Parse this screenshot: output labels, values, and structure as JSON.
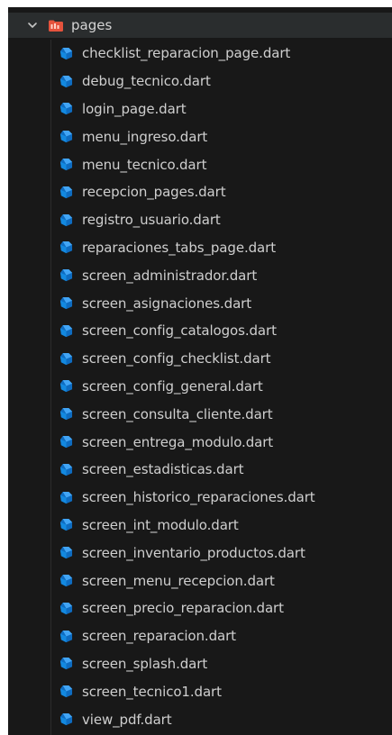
{
  "explorer": {
    "folder": {
      "name": "pages",
      "expanded": true,
      "chevron_icon": "chevron-down-icon",
      "icon": "folder-icon",
      "icon_color": "#e5533d"
    },
    "file_icon": "dart-icon",
    "file_icon_color": "#1a8fe0",
    "files": [
      {
        "name": "checklist_reparacion_page.dart"
      },
      {
        "name": "debug_tecnico.dart"
      },
      {
        "name": "login_page.dart"
      },
      {
        "name": "menu_ingreso.dart"
      },
      {
        "name": "menu_tecnico.dart"
      },
      {
        "name": "recepcion_pages.dart"
      },
      {
        "name": "registro_usuario.dart"
      },
      {
        "name": "reparaciones_tabs_page.dart"
      },
      {
        "name": "screen_administrador.dart"
      },
      {
        "name": "screen_asignaciones.dart"
      },
      {
        "name": "screen_config_catalogos.dart"
      },
      {
        "name": "screen_config_checklist.dart"
      },
      {
        "name": "screen_config_general.dart"
      },
      {
        "name": "screen_consulta_cliente.dart"
      },
      {
        "name": "screen_entrega_modulo.dart"
      },
      {
        "name": "screen_estadisticas.dart"
      },
      {
        "name": "screen_historico_reparaciones.dart"
      },
      {
        "name": "screen_int_modulo.dart"
      },
      {
        "name": "screen_inventario_productos.dart"
      },
      {
        "name": "screen_menu_recepcion.dart"
      },
      {
        "name": "screen_precio_reparacion.dart"
      },
      {
        "name": "screen_reparacion.dart"
      },
      {
        "name": "screen_splash.dart"
      },
      {
        "name": "screen_tecnico1.dart"
      },
      {
        "name": "view_pdf.dart"
      }
    ]
  }
}
